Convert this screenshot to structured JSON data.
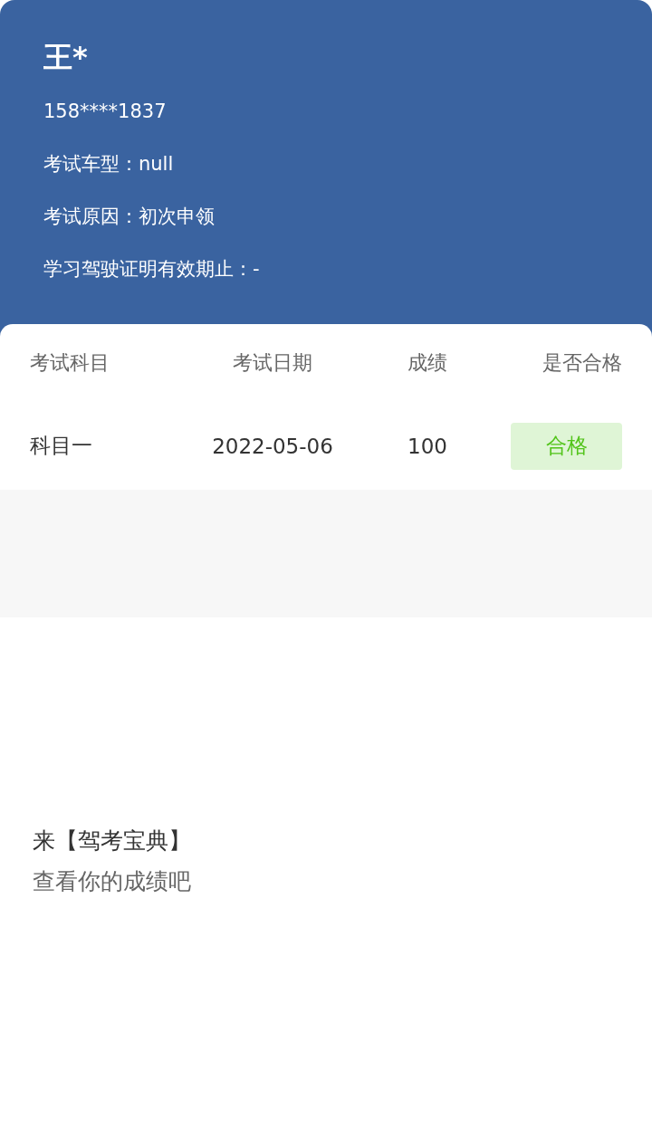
{
  "profile": {
    "name": "王*",
    "phone": "158****1837",
    "lines": [
      {
        "label": "考试车型：",
        "value": "null"
      },
      {
        "label": "考试原因：",
        "value": "初次申领"
      },
      {
        "label": "学习驾驶证明有效期止：",
        "value": "-"
      }
    ]
  },
  "table": {
    "columns": [
      "考试科目",
      "考试日期",
      "成绩",
      "是否合格"
    ],
    "rows": [
      {
        "subject": "科目一",
        "date": "2022-05-06",
        "score": "100",
        "result": "合格",
        "passed": true
      }
    ]
  },
  "promo": {
    "title": "来【驾考宝典】",
    "subtitle": "查看你的成绩吧"
  }
}
